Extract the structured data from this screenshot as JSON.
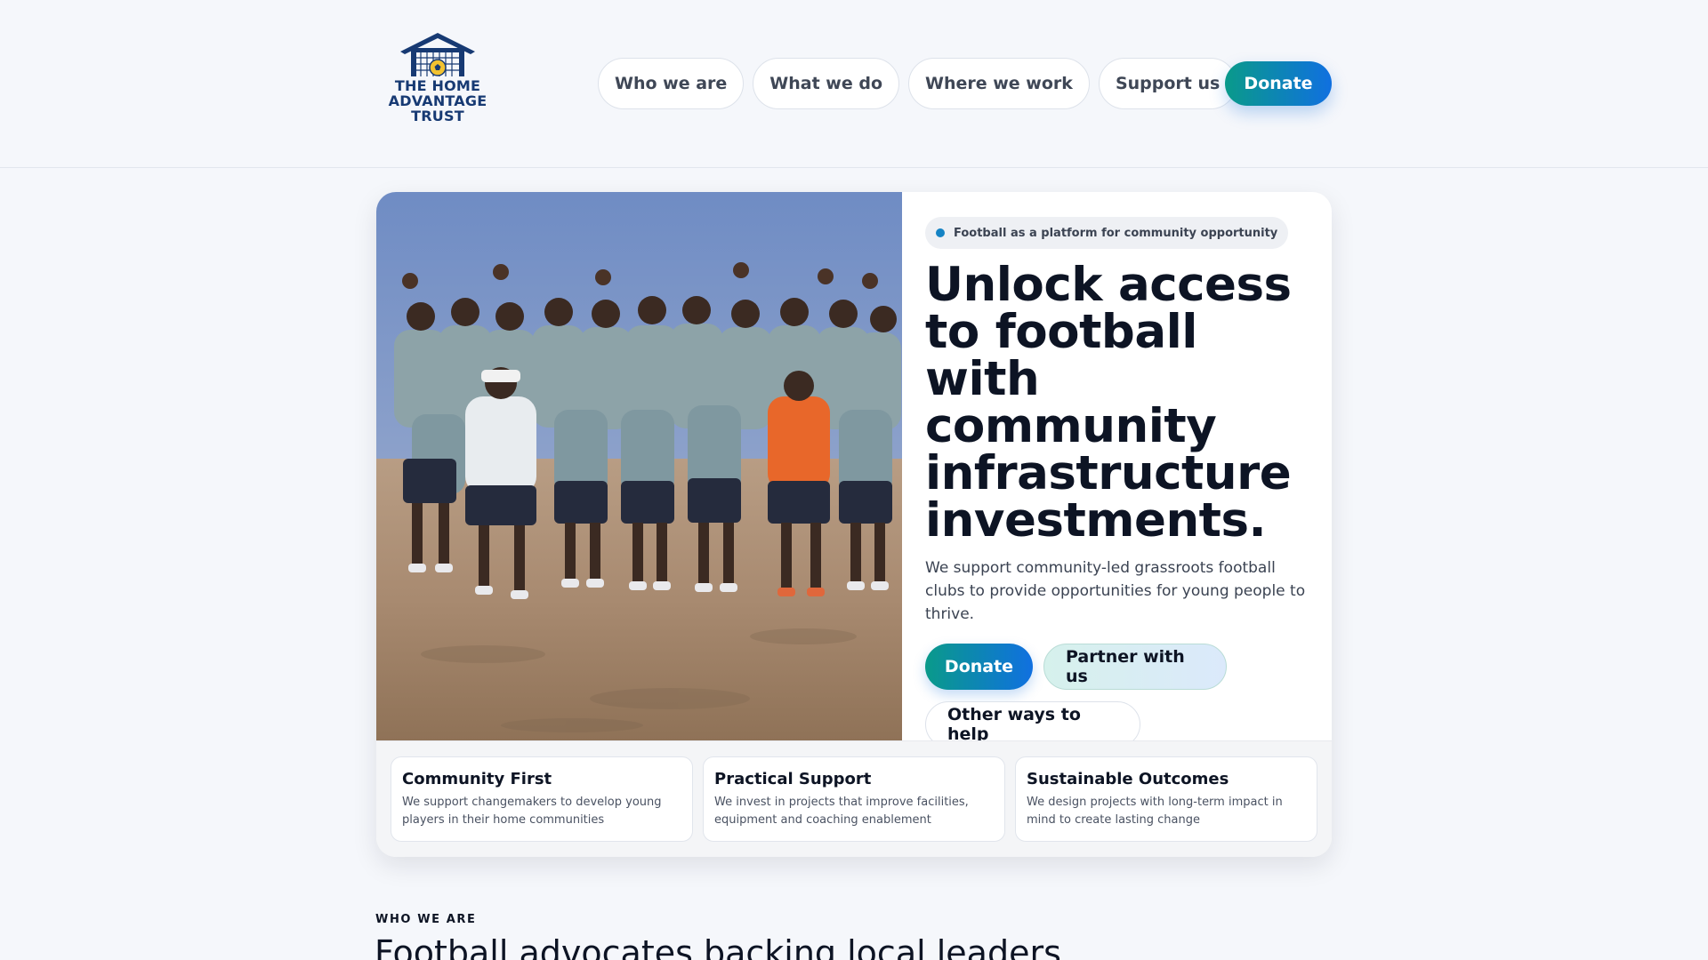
{
  "brand": {
    "logo_lines": [
      "THE HOME",
      "ADVANTAGE",
      "TRUST"
    ],
    "logo_icon": "goal-house-football-icon",
    "colors": {
      "navy": "#173a73",
      "gold": "#f2c230"
    }
  },
  "nav": {
    "items": [
      "Who we are",
      "What we do",
      "Where we work",
      "Support us"
    ],
    "donate_label": "Donate"
  },
  "hero": {
    "pill": "Football as a platform for community opportunity",
    "title": "Unlock access to football with community infrastructure investments.",
    "subtitle": "We support community-led grassroots football clubs to provide opportunities for young people to thrive.",
    "buttons": {
      "donate": "Donate",
      "partner": "Partner with us",
      "other": "Other ways to help"
    },
    "photo_alt": "group-photo-young-football-players"
  },
  "features": [
    {
      "title": "Community First",
      "desc": "We support changemakers to develop young players in their home communities"
    },
    {
      "title": "Practical Support",
      "desc": "We invest in projects that improve facilities, equipment and coaching enablement"
    },
    {
      "title": "Sustainable Outcomes",
      "desc": "We design projects with long-term impact in mind to create lasting change"
    }
  ],
  "section": {
    "eyebrow": "WHO WE ARE",
    "title": "Football advocates backing local leaders"
  },
  "colors": {
    "accent_start": "#0a9a8a",
    "accent_end": "#1070e0",
    "page_bg": "#f5f7fb",
    "text_dark": "#0d1424"
  }
}
